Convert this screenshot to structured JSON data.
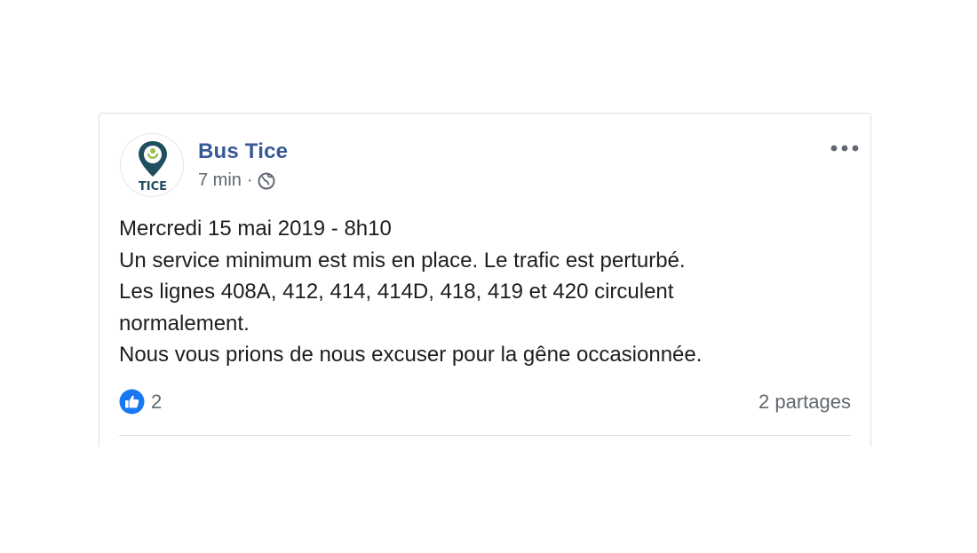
{
  "post": {
    "author": "Bus Tice",
    "avatar": {
      "logo_text": "TICE",
      "logo_color": "#1f4e5f",
      "accent_color": "#9cc24a"
    },
    "time": "7 min",
    "separator": "·",
    "privacy_icon": "globe-icon",
    "menu_icon": "more-horizontal-icon",
    "lines": [
      "Mercredi 15 mai 2019 - 8h10",
      "Un service minimum est mis en place. Le trafic est perturbé.",
      "Les lignes 408A, 412, 414, 414D, 418, 419 et 420 circulent",
      "normalement.",
      "Nous vous prions de nous excuser pour la gêne occasionnée."
    ]
  },
  "footer": {
    "reaction_icon": "like-icon",
    "reaction_color": "#1877f2",
    "reaction_count": "2",
    "shares": "2 partages"
  },
  "colors": {
    "author": "#385898",
    "meta": "#616770",
    "text": "#1c1e21",
    "border": "#dddfe2"
  }
}
